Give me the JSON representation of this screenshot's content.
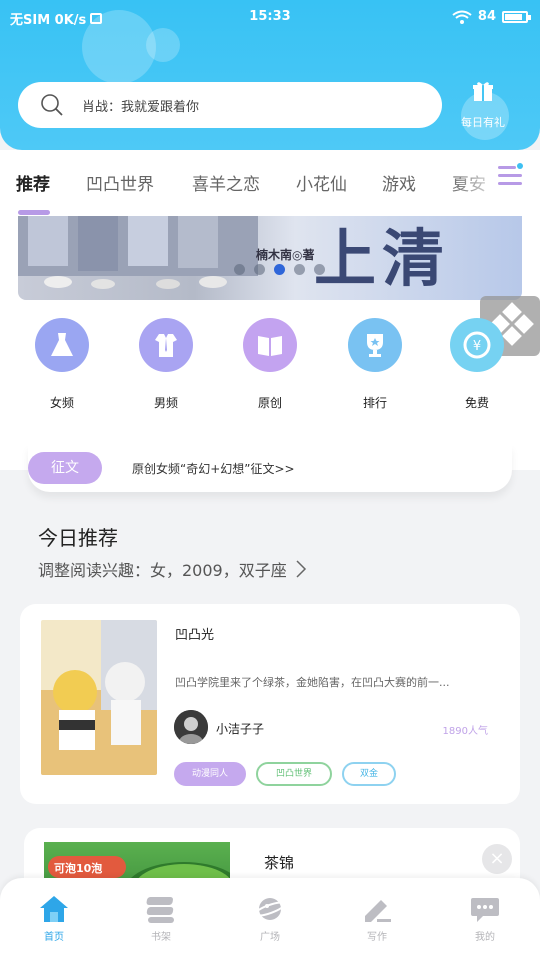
{
  "status_bar": {
    "carrier": "无SIM 0K/s",
    "time": "15:33",
    "battery_text": "84",
    "battery_level": 0.84
  },
  "search": {
    "placeholder": "肖战：我就爱跟着你"
  },
  "daily_gift": {
    "label": "每日有礼"
  },
  "tabs": [
    {
      "label": "推荐",
      "active": true
    },
    {
      "label": "凹凸世界",
      "active": false
    },
    {
      "label": "喜羊之恋",
      "active": false
    },
    {
      "label": "小花仙",
      "active": false
    },
    {
      "label": "游戏",
      "active": false
    },
    {
      "label": "夏安",
      "active": false
    }
  ],
  "banner": {
    "author": "楠木南◎著",
    "title": "上清",
    "dot_count": 5,
    "active_dot": 2
  },
  "categories": [
    {
      "label": "女频",
      "icon": "dress-icon",
      "color": "#9aa6f2"
    },
    {
      "label": "男频",
      "icon": "shirt-icon",
      "color": "#a9a4f2"
    },
    {
      "label": "原创",
      "icon": "book-icon",
      "color": "#c3a3f0"
    },
    {
      "label": "排行",
      "icon": "trophy-icon",
      "color": "#79c2f2"
    },
    {
      "label": "免费",
      "icon": "coin-icon",
      "color": "#76d2f2"
    }
  ],
  "notice": {
    "badge": "征文",
    "text": "原创女频“奇幻+幻想”征文>>"
  },
  "section": {
    "title": "今日推荐",
    "subtitle": "调整阅读兴趣：女，2009，双子座"
  },
  "book": {
    "title": "凹凸光",
    "description": "凹凸学院里来了个绿茶，金她陷害，在凹凸大赛的前一...",
    "author": "小洁子子",
    "popularity": "1890人气",
    "tags": [
      "动漫同人",
      "凹凸世界",
      "双金"
    ]
  },
  "book2": {
    "cover_badge": "可泡10泡",
    "title": "茶锦"
  },
  "bottom_nav": [
    {
      "label": "首页",
      "icon": "home-icon",
      "active": true
    },
    {
      "label": "书架",
      "icon": "bookshelf-icon",
      "active": false
    },
    {
      "label": "广场",
      "icon": "planet-icon",
      "active": false
    },
    {
      "label": "写作",
      "icon": "pen-icon",
      "active": false
    },
    {
      "label": "我的",
      "icon": "chat-icon",
      "active": false
    }
  ],
  "colors": {
    "header": "#38c2f4",
    "accent_purple": "#c5a9ee",
    "nav_active": "#2ea6e8"
  }
}
